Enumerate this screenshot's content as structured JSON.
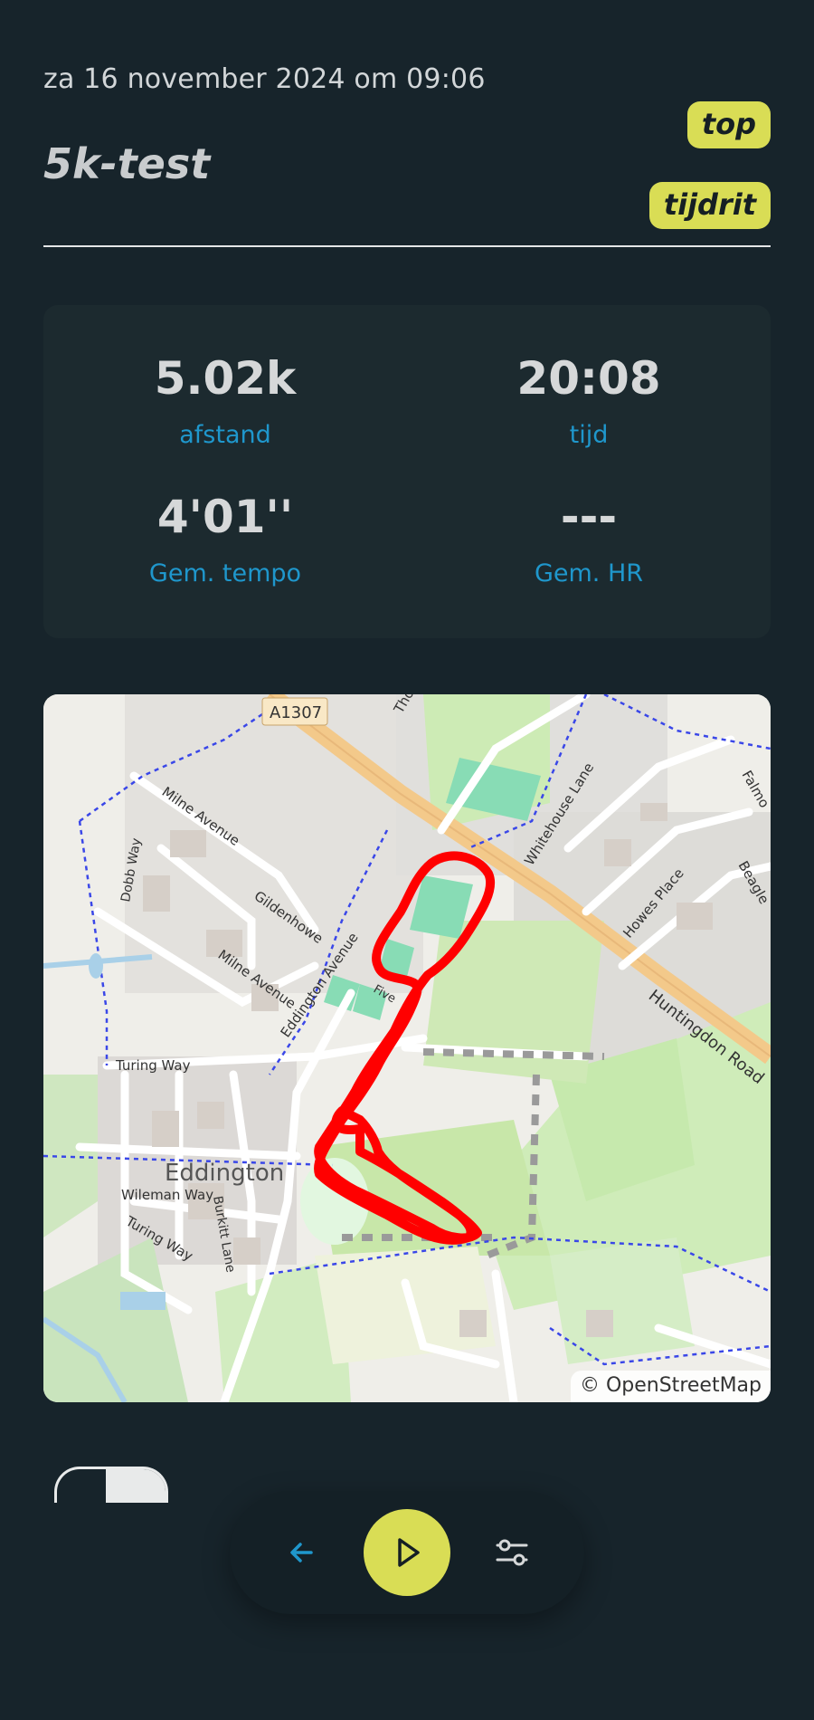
{
  "activity": {
    "date": "za 16 november 2024 om 09:06",
    "title": "5k-test",
    "tags": [
      "top",
      "tijdrit"
    ]
  },
  "stats": [
    {
      "value": "5.02k",
      "label": "afstand"
    },
    {
      "value": "20:08",
      "label": "tijd"
    },
    {
      "value": "4'01''",
      "label": "Gem. tempo"
    },
    {
      "value": "---",
      "label": "Gem. HR"
    }
  ],
  "map": {
    "attribution": "© OpenStreetMap",
    "labels": {
      "road_a1307": "A1307",
      "milne_avenue_1": "Milne Avenue",
      "milne_avenue_2": "Milne Avenue",
      "gildenhowe": "Gildenhowe",
      "eddington_avenue": "Eddington Avenue",
      "dobb_way": "Dobb Way",
      "turing_way_1": "Turing Way",
      "turing_way_2": "Turing Way",
      "eddington": "Eddington",
      "wileman_way": "Wileman Way",
      "burkitt_lane": "Burkitt Lane",
      "whitehouse_lane": "Whitehouse Lane",
      "howes_place": "Howes Place",
      "huntingdon_road": "Huntingdon Road",
      "beagle": "Beagle",
      "falmouth": "Falmo",
      "thornton": "Tho",
      "five": "Five"
    },
    "route_color": "#ff0000"
  },
  "nav": {
    "back_icon": "arrow-left-icon",
    "play_icon": "play-icon",
    "settings_icon": "sliders-icon",
    "accent": "#d9dd55",
    "link_color": "#1f97cc"
  }
}
